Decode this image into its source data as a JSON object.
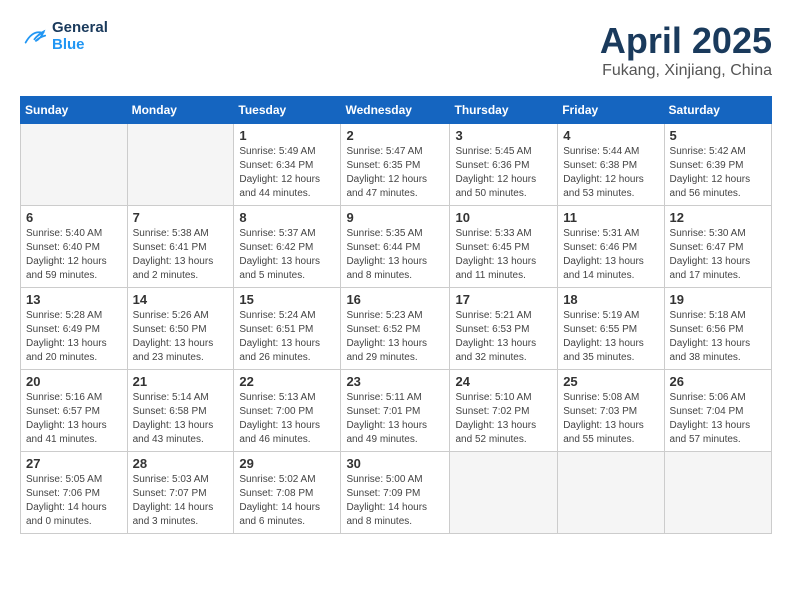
{
  "header": {
    "logo_line1": "General",
    "logo_line2": "Blue",
    "month_title": "April 2025",
    "location": "Fukang, Xinjiang, China"
  },
  "weekdays": [
    "Sunday",
    "Monday",
    "Tuesday",
    "Wednesday",
    "Thursday",
    "Friday",
    "Saturday"
  ],
  "weeks": [
    [
      {
        "day": "",
        "detail": ""
      },
      {
        "day": "",
        "detail": ""
      },
      {
        "day": "1",
        "detail": "Sunrise: 5:49 AM\nSunset: 6:34 PM\nDaylight: 12 hours and 44 minutes."
      },
      {
        "day": "2",
        "detail": "Sunrise: 5:47 AM\nSunset: 6:35 PM\nDaylight: 12 hours and 47 minutes."
      },
      {
        "day": "3",
        "detail": "Sunrise: 5:45 AM\nSunset: 6:36 PM\nDaylight: 12 hours and 50 minutes."
      },
      {
        "day": "4",
        "detail": "Sunrise: 5:44 AM\nSunset: 6:38 PM\nDaylight: 12 hours and 53 minutes."
      },
      {
        "day": "5",
        "detail": "Sunrise: 5:42 AM\nSunset: 6:39 PM\nDaylight: 12 hours and 56 minutes."
      }
    ],
    [
      {
        "day": "6",
        "detail": "Sunrise: 5:40 AM\nSunset: 6:40 PM\nDaylight: 12 hours and 59 minutes."
      },
      {
        "day": "7",
        "detail": "Sunrise: 5:38 AM\nSunset: 6:41 PM\nDaylight: 13 hours and 2 minutes."
      },
      {
        "day": "8",
        "detail": "Sunrise: 5:37 AM\nSunset: 6:42 PM\nDaylight: 13 hours and 5 minutes."
      },
      {
        "day": "9",
        "detail": "Sunrise: 5:35 AM\nSunset: 6:44 PM\nDaylight: 13 hours and 8 minutes."
      },
      {
        "day": "10",
        "detail": "Sunrise: 5:33 AM\nSunset: 6:45 PM\nDaylight: 13 hours and 11 minutes."
      },
      {
        "day": "11",
        "detail": "Sunrise: 5:31 AM\nSunset: 6:46 PM\nDaylight: 13 hours and 14 minutes."
      },
      {
        "day": "12",
        "detail": "Sunrise: 5:30 AM\nSunset: 6:47 PM\nDaylight: 13 hours and 17 minutes."
      }
    ],
    [
      {
        "day": "13",
        "detail": "Sunrise: 5:28 AM\nSunset: 6:49 PM\nDaylight: 13 hours and 20 minutes."
      },
      {
        "day": "14",
        "detail": "Sunrise: 5:26 AM\nSunset: 6:50 PM\nDaylight: 13 hours and 23 minutes."
      },
      {
        "day": "15",
        "detail": "Sunrise: 5:24 AM\nSunset: 6:51 PM\nDaylight: 13 hours and 26 minutes."
      },
      {
        "day": "16",
        "detail": "Sunrise: 5:23 AM\nSunset: 6:52 PM\nDaylight: 13 hours and 29 minutes."
      },
      {
        "day": "17",
        "detail": "Sunrise: 5:21 AM\nSunset: 6:53 PM\nDaylight: 13 hours and 32 minutes."
      },
      {
        "day": "18",
        "detail": "Sunrise: 5:19 AM\nSunset: 6:55 PM\nDaylight: 13 hours and 35 minutes."
      },
      {
        "day": "19",
        "detail": "Sunrise: 5:18 AM\nSunset: 6:56 PM\nDaylight: 13 hours and 38 minutes."
      }
    ],
    [
      {
        "day": "20",
        "detail": "Sunrise: 5:16 AM\nSunset: 6:57 PM\nDaylight: 13 hours and 41 minutes."
      },
      {
        "day": "21",
        "detail": "Sunrise: 5:14 AM\nSunset: 6:58 PM\nDaylight: 13 hours and 43 minutes."
      },
      {
        "day": "22",
        "detail": "Sunrise: 5:13 AM\nSunset: 7:00 PM\nDaylight: 13 hours and 46 minutes."
      },
      {
        "day": "23",
        "detail": "Sunrise: 5:11 AM\nSunset: 7:01 PM\nDaylight: 13 hours and 49 minutes."
      },
      {
        "day": "24",
        "detail": "Sunrise: 5:10 AM\nSunset: 7:02 PM\nDaylight: 13 hours and 52 minutes."
      },
      {
        "day": "25",
        "detail": "Sunrise: 5:08 AM\nSunset: 7:03 PM\nDaylight: 13 hours and 55 minutes."
      },
      {
        "day": "26",
        "detail": "Sunrise: 5:06 AM\nSunset: 7:04 PM\nDaylight: 13 hours and 57 minutes."
      }
    ],
    [
      {
        "day": "27",
        "detail": "Sunrise: 5:05 AM\nSunset: 7:06 PM\nDaylight: 14 hours and 0 minutes."
      },
      {
        "day": "28",
        "detail": "Sunrise: 5:03 AM\nSunset: 7:07 PM\nDaylight: 14 hours and 3 minutes."
      },
      {
        "day": "29",
        "detail": "Sunrise: 5:02 AM\nSunset: 7:08 PM\nDaylight: 14 hours and 6 minutes."
      },
      {
        "day": "30",
        "detail": "Sunrise: 5:00 AM\nSunset: 7:09 PM\nDaylight: 14 hours and 8 minutes."
      },
      {
        "day": "",
        "detail": ""
      },
      {
        "day": "",
        "detail": ""
      },
      {
        "day": "",
        "detail": ""
      }
    ]
  ]
}
